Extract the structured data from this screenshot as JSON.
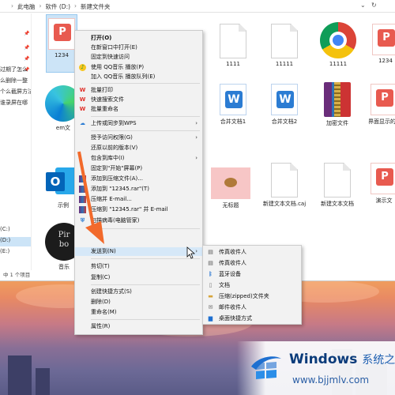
{
  "address_bar": {
    "path": [
      "此电脑",
      "软件 (D:)",
      "新建文件夹"
    ],
    "controls": [
      "↑",
      "↻"
    ]
  },
  "nav_pane": {
    "items": [
      "过期了怎么",
      "么删除一整",
      "个么截屏方法",
      "谁录屏在哪",
      "(C:)",
      "(D:)",
      "(E:)"
    ],
    "selected_index": 5
  },
  "status_bar": {
    "text": "中 1 个项目"
  },
  "files": [
    {
      "name": "1234",
      "icon": "pdf-folder-icon"
    },
    {
      "name": "1111",
      "icon": "document-icon"
    },
    {
      "name": "11111",
      "icon": "document-icon"
    },
    {
      "name": "11111",
      "icon": "chrome-icon"
    },
    {
      "name": "1234",
      "icon": "pdf-icon"
    },
    {
      "name": "em文",
      "icon": "edge-icon"
    },
    {
      "name": "合并文档1",
      "icon": "word-icon"
    },
    {
      "name": "合并文档2",
      "icon": "word-icon"
    },
    {
      "name": "加密文件",
      "icon": "winrar-icon"
    },
    {
      "name": "界面显示的解决方",
      "icon": "pdf-icon"
    },
    {
      "name": "示例",
      "icon": "outlook-icon"
    },
    {
      "name": "无标题",
      "icon": "image-icon"
    },
    {
      "name": "新建文本文档.caj",
      "icon": "document-icon"
    },
    {
      "name": "新建文本文档",
      "icon": "document-icon"
    },
    {
      "name": "演示文",
      "icon": "pdf-icon"
    },
    {
      "name": "音乐",
      "icon": "pirate-bay-icon"
    }
  ],
  "context_menu": {
    "items": [
      {
        "label": "打开(O)",
        "bold": true
      },
      {
        "label": "在新窗口中打开(E)"
      },
      {
        "label": "固定到快速访问"
      },
      {
        "label": "使用 QQ音乐 播放(P)",
        "icon": "qq-music-icon"
      },
      {
        "label": "加入 QQ音乐 播放队列(E)"
      },
      {
        "label": "批量打印",
        "icon": "wps-icon"
      },
      {
        "label": "快速搜索文件",
        "icon": "wps-icon"
      },
      {
        "label": "批量重命名",
        "icon": "wps-icon"
      },
      {
        "label": "上传或同步到WPS",
        "icon": "cloud-icon",
        "submenu": true
      },
      {
        "label": "授予访问权限(G)",
        "submenu": true
      },
      {
        "label": "还原以前的版本(V)"
      },
      {
        "label": "包含到库中(I)",
        "submenu": true
      },
      {
        "label": "固定到\"开始\"屏幕(P)"
      },
      {
        "label": "添加到压缩文件(A)...",
        "icon": "winrar-icon"
      },
      {
        "label": "添加到 \"12345.rar\"(T)",
        "icon": "winrar-icon"
      },
      {
        "label": "压缩并 E-mail...",
        "icon": "winrar-icon"
      },
      {
        "label": "压缩到 \"12345.rar\" 并 E-mail",
        "icon": "winrar-icon"
      },
      {
        "label": "扫描病毒(电脑管家)",
        "icon": "shield-icon"
      },
      {
        "label": "发送到(N)",
        "submenu": true,
        "highlight": true
      },
      {
        "label": "剪切(T)"
      },
      {
        "label": "复制(C)"
      },
      {
        "label": "创建快捷方式(S)"
      },
      {
        "label": "删除(D)"
      },
      {
        "label": "重命名(M)"
      },
      {
        "label": "属性(R)"
      }
    ]
  },
  "send_to_submenu": {
    "items": [
      {
        "label": "传真收件人",
        "icon": "fax-icon"
      },
      {
        "label": "传真收件人",
        "icon": "fax-icon"
      },
      {
        "label": "蓝牙设备",
        "icon": "bluetooth-icon"
      },
      {
        "label": "文档",
        "icon": "documents-icon"
      },
      {
        "label": "压缩(zipped)文件夹",
        "icon": "zip-folder-icon"
      },
      {
        "label": "邮件收件人",
        "icon": "mail-icon"
      },
      {
        "label": "桌面快捷方式",
        "icon": "desktop-icon"
      }
    ]
  },
  "watermark": {
    "brand": "Windows",
    "brand_cn": "系统之家",
    "url": "www.bjjmlv.com"
  },
  "colors": {
    "menu_bg": "#f2f2f2",
    "highlight": "#d6e8f8",
    "annotation_arrow": "#f26a2b",
    "selection": "#cce4f7"
  }
}
